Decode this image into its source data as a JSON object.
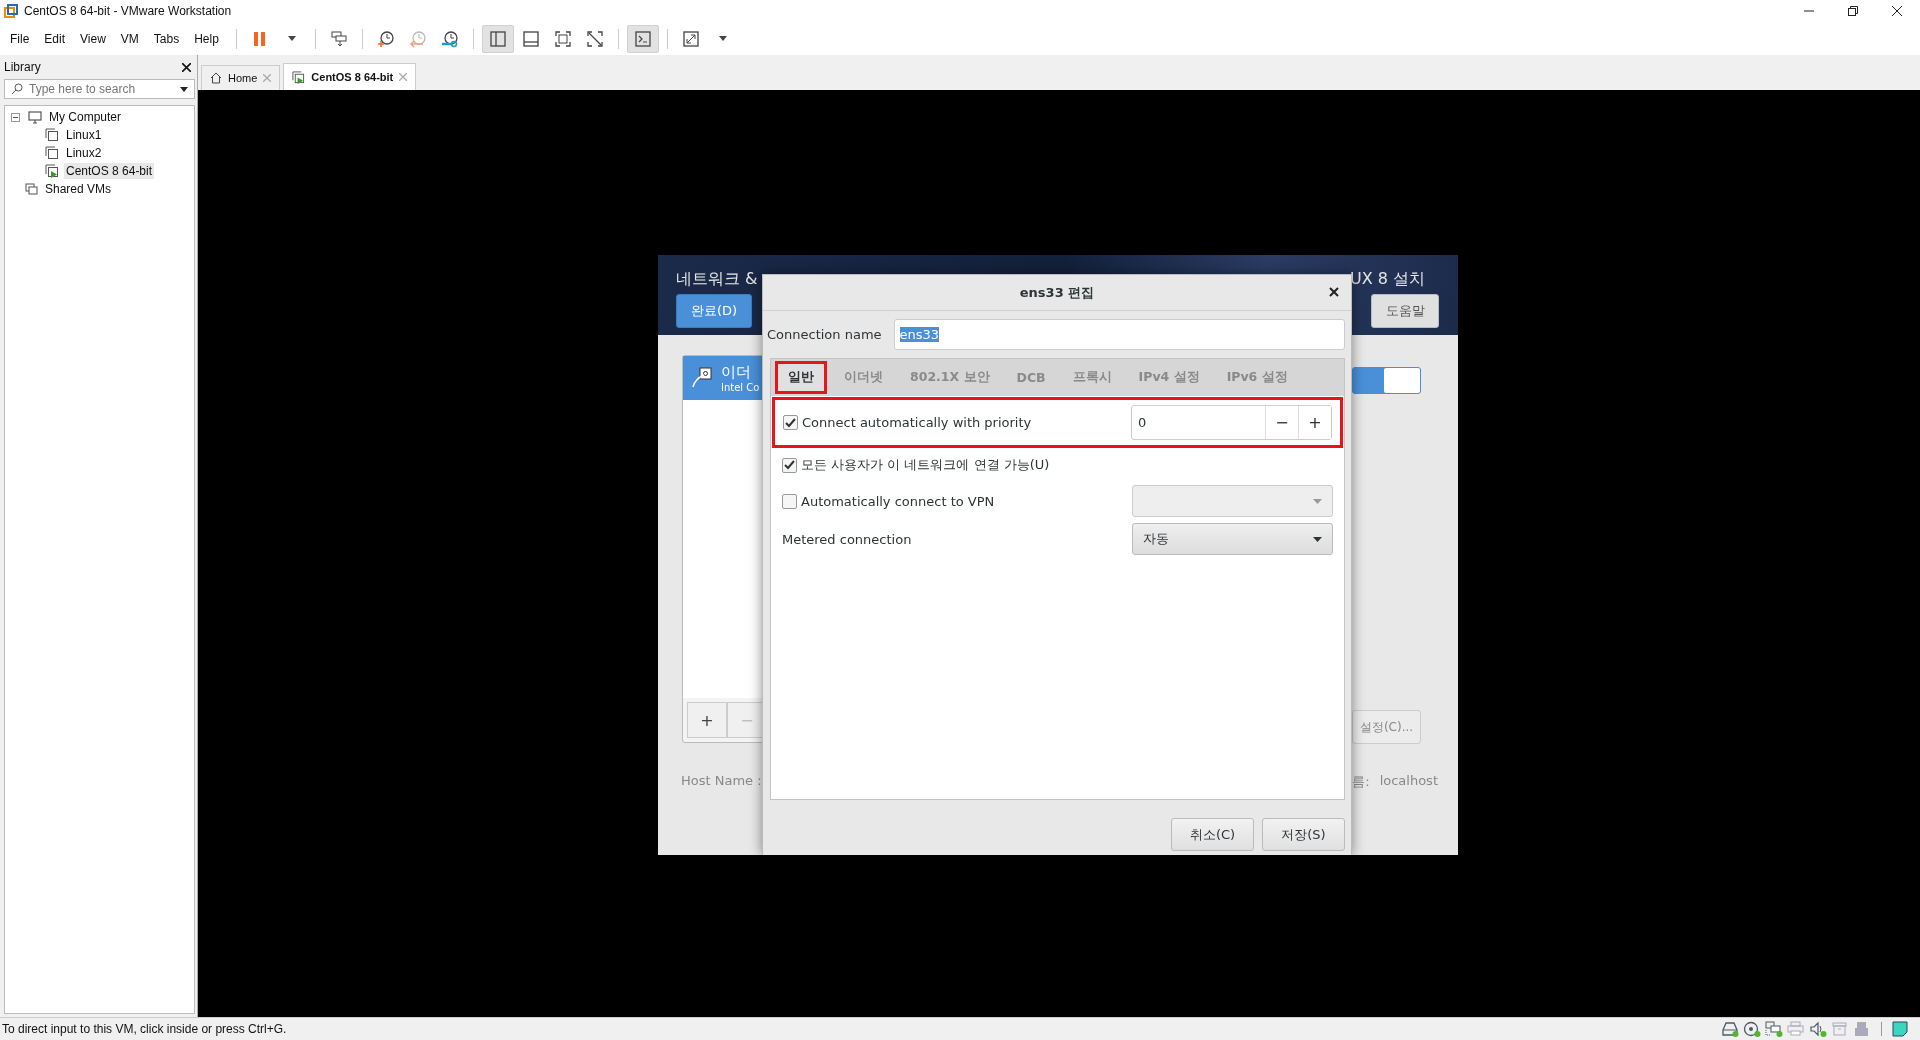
{
  "window": {
    "title": "CentOS 8 64-bit - VMware Workstation"
  },
  "menu": [
    "File",
    "Edit",
    "View",
    "VM",
    "Tabs",
    "Help"
  ],
  "toolbar": [
    {
      "kind": "pause",
      "pressed": false
    },
    {
      "kind": "caret",
      "pressed": false
    },
    {
      "kind": "send-keys",
      "pressed": false
    },
    {
      "kind": "snapshot-take",
      "pressed": false
    },
    {
      "kind": "snapshot-revert",
      "pressed": false
    },
    {
      "kind": "snapshot-manage",
      "pressed": false
    },
    {
      "kind": "view-library",
      "pressed": true
    },
    {
      "kind": "view-thumbs",
      "pressed": false
    },
    {
      "kind": "view-full",
      "pressed": false
    },
    {
      "kind": "view-unity",
      "pressed": false
    },
    {
      "kind": "console",
      "pressed": true
    },
    {
      "kind": "stretch",
      "pressed": false
    },
    {
      "kind": "caret",
      "pressed": false
    }
  ],
  "library": {
    "title": "Library",
    "search": {
      "placeholder": "Type here to search"
    },
    "tree": [
      {
        "label": "My Computer",
        "kind": "computer",
        "selected": false,
        "expanded": true,
        "children": [
          {
            "label": "Linux1",
            "kind": "vm",
            "selected": false,
            "running": false
          },
          {
            "label": "Linux2",
            "kind": "vm",
            "selected": false,
            "running": false
          },
          {
            "label": "CentOS 8 64-bit",
            "kind": "vm",
            "selected": true,
            "running": true
          }
        ]
      },
      {
        "label": "Shared VMs",
        "kind": "shared",
        "selected": false
      }
    ]
  },
  "tabs": [
    {
      "label": "Home",
      "kind": "home",
      "selected": false
    },
    {
      "label": "CentOS 8 64-bit",
      "kind": "vm",
      "selected": true
    }
  ],
  "installer": {
    "title": "네트워크 &",
    "product": "UX 8 설치",
    "done_button": "완료(D)",
    "help_button": "도움말",
    "device": {
      "name": "이더",
      "detail": "Intel Co",
      "selected": true
    },
    "add_button": "+",
    "remove_button": "−",
    "toggle": {
      "on": true
    },
    "configure_button": "설정(C)...",
    "host_label": "Host Name :",
    "current_host_label": "름:",
    "current_host": "localhost"
  },
  "dialog": {
    "title": "ens33 편집",
    "connection_name_label": "Connection name",
    "connection_name": "ens33",
    "connection_name_selected": true,
    "tabs": [
      {
        "label": "일반",
        "selected": true,
        "outlined": true
      },
      {
        "label": "이더넷",
        "selected": false,
        "outlined": false
      },
      {
        "label": "802.1X 보안",
        "selected": false,
        "outlined": false
      },
      {
        "label": "DCB",
        "selected": false,
        "outlined": false
      },
      {
        "label": "프록시",
        "selected": false,
        "outlined": false
      },
      {
        "label": "IPv4 설정",
        "selected": false,
        "outlined": false
      },
      {
        "label": "IPv6 설정",
        "selected": false,
        "outlined": false
      }
    ],
    "rows": [
      {
        "kind": "priority",
        "label": "Connect automatically with priority",
        "checked": true,
        "value": "0",
        "decrement": "−",
        "increment": "+",
        "outlined": true
      },
      {
        "kind": "check",
        "label": "모든 사용자가 이 네트워크에 연결 가능(U)",
        "checked": true,
        "outlined": false
      },
      {
        "kind": "check-dropdown",
        "label": "Automatically connect to VPN",
        "checked": false,
        "outlined": false
      },
      {
        "kind": "dropdown",
        "label": "Metered connection",
        "value": "자동",
        "outlined": false
      }
    ],
    "cancel_button": "취소(C)",
    "save_button": "저장(S)"
  },
  "status_bar": {
    "message": "To direct input to this VM, click inside or press Ctrl+G.",
    "devices": [
      {
        "kind": "disk",
        "connected": true
      },
      {
        "kind": "cd",
        "connected": true
      },
      {
        "kind": "network",
        "connected": true
      },
      {
        "kind": "printer",
        "connected": false
      },
      {
        "kind": "sound",
        "connected": true
      },
      {
        "kind": "archive",
        "connected": false
      },
      {
        "kind": "usb",
        "connected": false
      }
    ]
  }
}
